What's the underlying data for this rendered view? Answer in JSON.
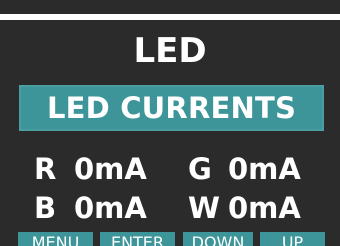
{
  "screen": {
    "title": "LED",
    "banner": "LED CURRENTS"
  },
  "readings": [
    {
      "channel": "R",
      "value": "0mA"
    },
    {
      "channel": "G",
      "value": "0mA"
    },
    {
      "channel": "B",
      "value": "0mA"
    },
    {
      "channel": "W",
      "value": "0mA"
    }
  ],
  "softkeys": {
    "menu": "MENU",
    "enter": "ENTER",
    "down": "DOWN",
    "up": "UP"
  },
  "colors": {
    "background": "#2b2b2b",
    "accent": "#3d959a",
    "text": "#ffffff"
  }
}
